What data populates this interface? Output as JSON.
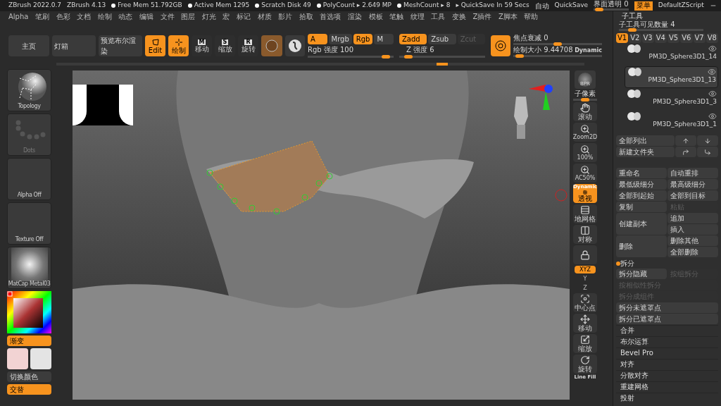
{
  "top_bar": {
    "versions": [
      "ZBrush 2022.0.7",
      "ZBrush 4.13"
    ],
    "status": [
      {
        "kind": "dot",
        "text": "Free Mem 51.792GB"
      },
      {
        "kind": "dot",
        "text": "Active Mem 1295"
      },
      {
        "kind": "dot",
        "text": "Scratch Disk 49"
      },
      {
        "kind": "dot",
        "text": "PolyCount ▸ 2.649 MP"
      },
      {
        "kind": "dot",
        "text": "MeshCount ▸ 8"
      },
      {
        "kind": "plain",
        "text": "▸ QuickSave In 59 Secs"
      }
    ],
    "auto": "自动",
    "quicksave": "QuickSave",
    "transparency": {
      "label": "界面透明 0",
      "level": 0.05
    },
    "menu_button": {
      "label": "菜单",
      "selected": true
    },
    "script": "DefaultZScript"
  },
  "menus": [
    "Alpha",
    "笔刷",
    "色彩",
    "文档",
    "绘制",
    "动态",
    "编辑",
    "文件",
    "图层",
    "灯光",
    "宏",
    "标记",
    "材质",
    "影片",
    "拾取",
    "首选项",
    "渲染",
    "模板",
    "笔触",
    "纹理",
    "工具",
    "变换",
    "Z插件",
    "Z脚本",
    "帮助"
  ],
  "toolbar": {
    "buttons": [
      "主页",
      "灯箱",
      "预览布尔渲染"
    ],
    "modes": [
      {
        "kind": "edit",
        "label": "Edit",
        "selected": true
      },
      {
        "kind": "draw",
        "label": "绘制",
        "selected": true
      },
      {
        "kind": "letter",
        "label": "移动",
        "letter": "M",
        "selected": false
      },
      {
        "kind": "letter",
        "label": "缩放",
        "letter": "S",
        "selected": false
      },
      {
        "kind": "letter",
        "label": "旋转",
        "letter": "R",
        "selected": false
      }
    ],
    "color_toggles": [
      {
        "label": "A",
        "selected": true,
        "disabled": false
      },
      {
        "label": "Mrgb",
        "selected": false,
        "disabled": false
      },
      {
        "label": "Rgb",
        "selected": true,
        "disabled": false
      },
      {
        "label": "M",
        "selected": false,
        "disabled": false
      }
    ],
    "rgb_intensity": {
      "label": "Rgb 强度 100",
      "level": 0.95
    },
    "z_toggles": [
      {
        "label": "Zadd",
        "selected": true,
        "disabled": false
      },
      {
        "label": "Zsub",
        "selected": false,
        "disabled": false
      },
      {
        "label": "Zcut",
        "selected": false,
        "disabled": true
      }
    ],
    "z_intensity": {
      "label": "Z 强度 6",
      "level": 0.06
    },
    "focal_shift": {
      "label": "焦点衰减 0",
      "level": 0.5
    },
    "draw_size": {
      "label": "绘制大小 9.44708",
      "level": 0.03
    },
    "dynamic": "Dynamic"
  },
  "left_panel": {
    "tiles": [
      {
        "kind": "topology",
        "label": "Topology",
        "disabled": false
      },
      {
        "kind": "dots",
        "label": "Dots",
        "disabled": true
      },
      {
        "kind": "empty",
        "label": "Alpha Off",
        "disabled": false
      },
      {
        "kind": "empty",
        "label": "Texture Off",
        "disabled": false
      },
      {
        "kind": "matcap",
        "label": "MatCap Metal03",
        "disabled": false
      }
    ],
    "gradient": {
      "label": "渐变",
      "on": true
    },
    "swatches": [
      {
        "color": "#f2d3d3"
      },
      {
        "color": "#e4e4e4"
      }
    ],
    "switch_color": {
      "label": "切换颜色",
      "on": false
    },
    "alternate": {
      "label": "交替",
      "on": true
    }
  },
  "right_tools": [
    {
      "kind": "bpr",
      "label": "BPR",
      "on": false
    },
    {
      "kind": "slider",
      "label": "子像素",
      "level": 0.5
    },
    {
      "kind": "scroll",
      "label": "滚动",
      "on": false
    },
    {
      "kind": "zoom",
      "label": "Zoom2D",
      "on": false
    },
    {
      "kind": "zoom",
      "label": "100%",
      "on": false
    },
    {
      "kind": "zoom",
      "label": "AC50%",
      "on": false
    },
    {
      "kind": "persp",
      "label": "透视",
      "sub": "Dynamic",
      "on": true
    },
    {
      "kind": "floor",
      "label": "地网格",
      "on": false
    },
    {
      "kind": "sym",
      "label": "对称",
      "on": false
    },
    {
      "kind": "lock",
      "on": false
    },
    {
      "kind": "axis",
      "label": "XYZ",
      "on": true
    },
    {
      "kind": "axis",
      "label": "Y",
      "on": false
    },
    {
      "kind": "axis",
      "label": "Z",
      "on": false
    },
    {
      "kind": "center",
      "label": "中心点",
      "on": false
    },
    {
      "kind": "move",
      "label": "移动",
      "on": false
    },
    {
      "kind": "scale",
      "label": "缩放",
      "on": false
    },
    {
      "kind": "rotate",
      "label": "旋转",
      "on": false
    },
    {
      "kind": "text",
      "label": "Line Fill"
    }
  ],
  "subtool": {
    "title": "子工具",
    "visible_count": {
      "label": "子工具可见数量 4",
      "level": 0.12
    },
    "versions": [
      {
        "label": "V1",
        "selected": true
      },
      {
        "label": "V2",
        "selected": false
      },
      {
        "label": "V3",
        "selected": false
      },
      {
        "label": "V4",
        "selected": false
      },
      {
        "label": "V5",
        "selected": false
      },
      {
        "label": "V6",
        "selected": false
      },
      {
        "label": "V7",
        "selected": false
      },
      {
        "label": "V8",
        "selected": false
      }
    ],
    "items": [
      {
        "name": "PM3D_Sphere3D1_14",
        "selected": false
      },
      {
        "name": "PM3D_Sphere3D1_13",
        "selected": true
      },
      {
        "name": "PM3D_Sphere3D1_3",
        "selected": false
      },
      {
        "name": "PM3D_Sphere3D1_1",
        "selected": false
      }
    ],
    "list_all": "全部列出",
    "new_folder": "新建文件夹",
    "actions": [
      {
        "label": "重命名",
        "disabled": false
      },
      {
        "label": "自动重排",
        "disabled": false
      },
      {
        "label": "最低级细分",
        "disabled": false
      },
      {
        "label": "最高级细分",
        "disabled": false
      },
      {
        "label": "全部到起始",
        "disabled": false
      },
      {
        "label": "全部到目标",
        "disabled": false
      },
      {
        "label": "复制",
        "disabled": false
      },
      {
        "label": "粘贴",
        "disabled": true
      }
    ],
    "duplicate": "创建副本",
    "append": "追加",
    "insert": "插入",
    "delete": "删除",
    "delete_other": "删除其他",
    "delete_all": "全部删除",
    "split": {
      "title": "拆分",
      "row": [
        {
          "label": "拆分隐藏",
          "disabled": false
        },
        {
          "label": "按组拆分",
          "disabled": true
        }
      ],
      "buttons": [
        {
          "label": "按相似性拆分",
          "disabled": true
        },
        {
          "label": "拆分成组件",
          "disabled": true
        },
        {
          "label": "拆分未遮罩点",
          "disabled": false
        },
        {
          "label": "拆分已遮罩点",
          "disabled": false
        }
      ]
    },
    "sections": [
      "合并",
      "布尔运算",
      "Bevel Pro",
      "对齐",
      "分散对齐",
      "重建网格",
      "投射"
    ]
  }
}
